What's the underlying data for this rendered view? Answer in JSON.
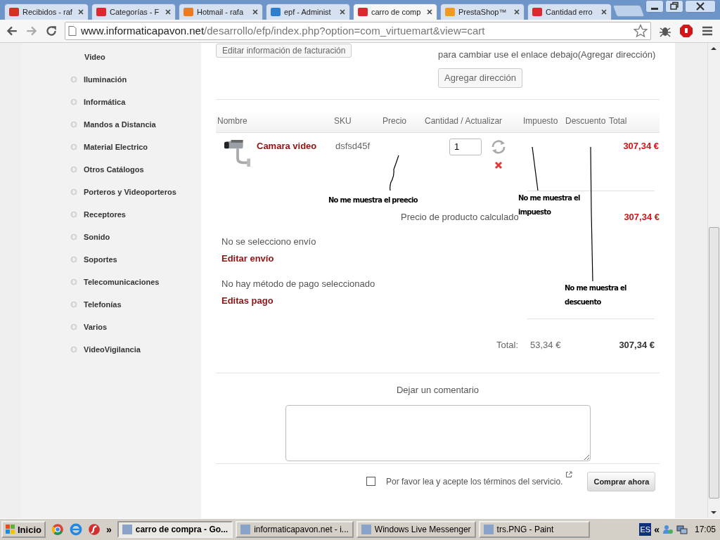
{
  "browser": {
    "tabs": [
      {
        "title": "Recibidos - raf",
        "selected": false,
        "color": "#d93025"
      },
      {
        "title": "Categorías - F",
        "selected": false,
        "color": "#e0262e"
      },
      {
        "title": "Hotmail - rafa",
        "selected": false,
        "color": "#f07a1c"
      },
      {
        "title": "epf - Administ",
        "selected": false,
        "color": "#2d7fd0"
      },
      {
        "title": "carro de comp",
        "selected": true,
        "color": "#e0262e"
      },
      {
        "title": "PrestaShop™",
        "selected": false,
        "color": "#f29a1d"
      },
      {
        "title": "Cantidad erro",
        "selected": false,
        "color": "#e0262e"
      }
    ],
    "url_host": "www.informaticapavon.net",
    "url_path": "/desarrollo/efp/index.php?option=com_virtuemart&view=cart"
  },
  "sidebar": {
    "items": [
      {
        "label": "Video",
        "kind": "sub"
      },
      {
        "label": "Iluminación",
        "kind": "category"
      },
      {
        "label": "Informática",
        "kind": "category"
      },
      {
        "label": "Mandos a Distancia",
        "kind": "category"
      },
      {
        "label": "Material Electrico",
        "kind": "category"
      },
      {
        "label": "Otros Catálogos",
        "kind": "category"
      },
      {
        "label": "Porteros y Videoporteros",
        "kind": "category"
      },
      {
        "label": "Receptores",
        "kind": "category"
      },
      {
        "label": "Sonido",
        "kind": "category"
      },
      {
        "label": "Soportes",
        "kind": "category"
      },
      {
        "label": "Telecomunicaciones",
        "kind": "category"
      },
      {
        "label": "Telefonías",
        "kind": "category"
      },
      {
        "label": "Varios",
        "kind": "category"
      },
      {
        "label": "VideoVigilancia",
        "kind": "category"
      }
    ]
  },
  "billing": {
    "edit_button": "Editar información de facturación",
    "address_note": "para cambiar use el enlace debajo(Agregar dirección)",
    "add_address_button": "Agregar dirección"
  },
  "cart": {
    "columns": [
      "Nombre",
      "SKU",
      "Precio",
      "Cantidad / Actualizar",
      "Impuesto",
      "Descuento",
      "Total"
    ],
    "rows": [
      {
        "name": "Camara video",
        "sku": "dsfsd45f",
        "quantity": "1",
        "total": "307,34 €"
      }
    ],
    "subtotal_label": "Precio de producto calculado",
    "subtotal": "307,34 €",
    "shipping_note": "No se selecciono envío",
    "shipping_link": "Editar envío",
    "payment_note": "No hay método de pago seleccionado",
    "payment_link": "Editas pago",
    "total_label": "Total:",
    "total_tax": "53,34 €",
    "total": "307,34 €"
  },
  "comment": {
    "label": "Dejar un comentario"
  },
  "terms": {
    "checked": false,
    "text": "Por favor lea y acepte los términos del servicio."
  },
  "buy_button": "Comprar ahora",
  "annotations": [
    {
      "text": "No me muestra el preecio"
    },
    {
      "text": "No me muestra el impuesto"
    },
    {
      "text": "No me muestra el descuento"
    }
  ],
  "taskbar": {
    "start": "Inicio",
    "more": "»",
    "tasks": [
      {
        "label": "carro de compra - Go...",
        "selected": true
      },
      {
        "label": "informaticapavon.net - i...",
        "selected": false
      },
      {
        "label": "Windows Live Messenger",
        "selected": false
      },
      {
        "label": "trs.PNG - Paint",
        "selected": false
      }
    ],
    "language": "ES",
    "tray_arrow": "«",
    "clock": "17:05"
  }
}
